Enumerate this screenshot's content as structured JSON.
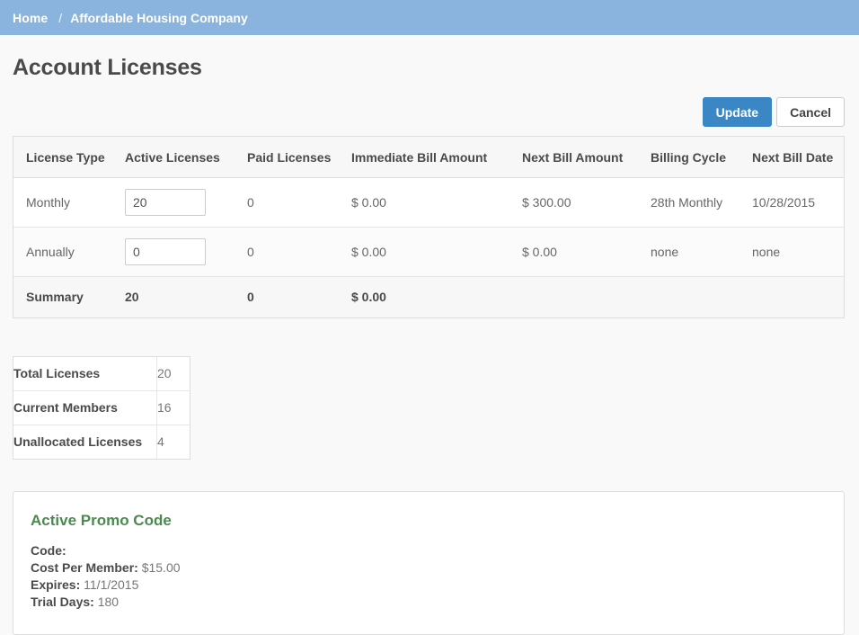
{
  "breadcrumb": {
    "home_label": "Home",
    "separator": "/",
    "current_label": "Affordable Housing Company"
  },
  "page": {
    "title": "Account Licenses"
  },
  "toolbar": {
    "update_label": "Update",
    "cancel_label": "Cancel"
  },
  "licenses_table": {
    "columns": [
      "License Type",
      "Active Licenses",
      "Paid Licenses",
      "Immediate Bill Amount",
      "Next Bill Amount",
      "Billing Cycle",
      "Next Bill Date"
    ],
    "rows": [
      {
        "license_type": "Monthly",
        "active_licenses": "20",
        "paid_licenses": "0",
        "immediate_bill_amount": "$ 0.00",
        "next_bill_amount": "$ 300.00",
        "billing_cycle": "28th Monthly",
        "next_bill_date": "10/28/2015"
      },
      {
        "license_type": "Annually",
        "active_licenses": "0",
        "paid_licenses": "0",
        "immediate_bill_amount": "$ 0.00",
        "next_bill_amount": "$ 0.00",
        "billing_cycle": "none",
        "next_bill_date": "none"
      }
    ],
    "summary": {
      "license_type": "Summary",
      "active_licenses": "20",
      "paid_licenses": "0",
      "immediate_bill_amount": "$ 0.00",
      "next_bill_amount": "",
      "billing_cycle": "",
      "next_bill_date": ""
    }
  },
  "totals": {
    "rows": [
      {
        "label": "Total Licenses",
        "value": "20"
      },
      {
        "label": "Current Members",
        "value": "16"
      },
      {
        "label": "Unallocated Licenses",
        "value": "4"
      }
    ]
  },
  "promo": {
    "title": "Active Promo Code",
    "code_label": "Code:",
    "code_value": "",
    "cost_label": "Cost Per Member:",
    "cost_value": "$15.00",
    "expires_label": "Expires:",
    "expires_value": "11/1/2015",
    "trial_label": "Trial Days:",
    "trial_value": "180"
  },
  "colors": {
    "breadcrumb_bg": "#8ab4dd",
    "primary_button": "#3b87c6",
    "promo_title": "#4b8a4f",
    "page_bg": "#f9f9f9",
    "table_header_bg": "#f7f7f7",
    "border": "#dddddd"
  }
}
